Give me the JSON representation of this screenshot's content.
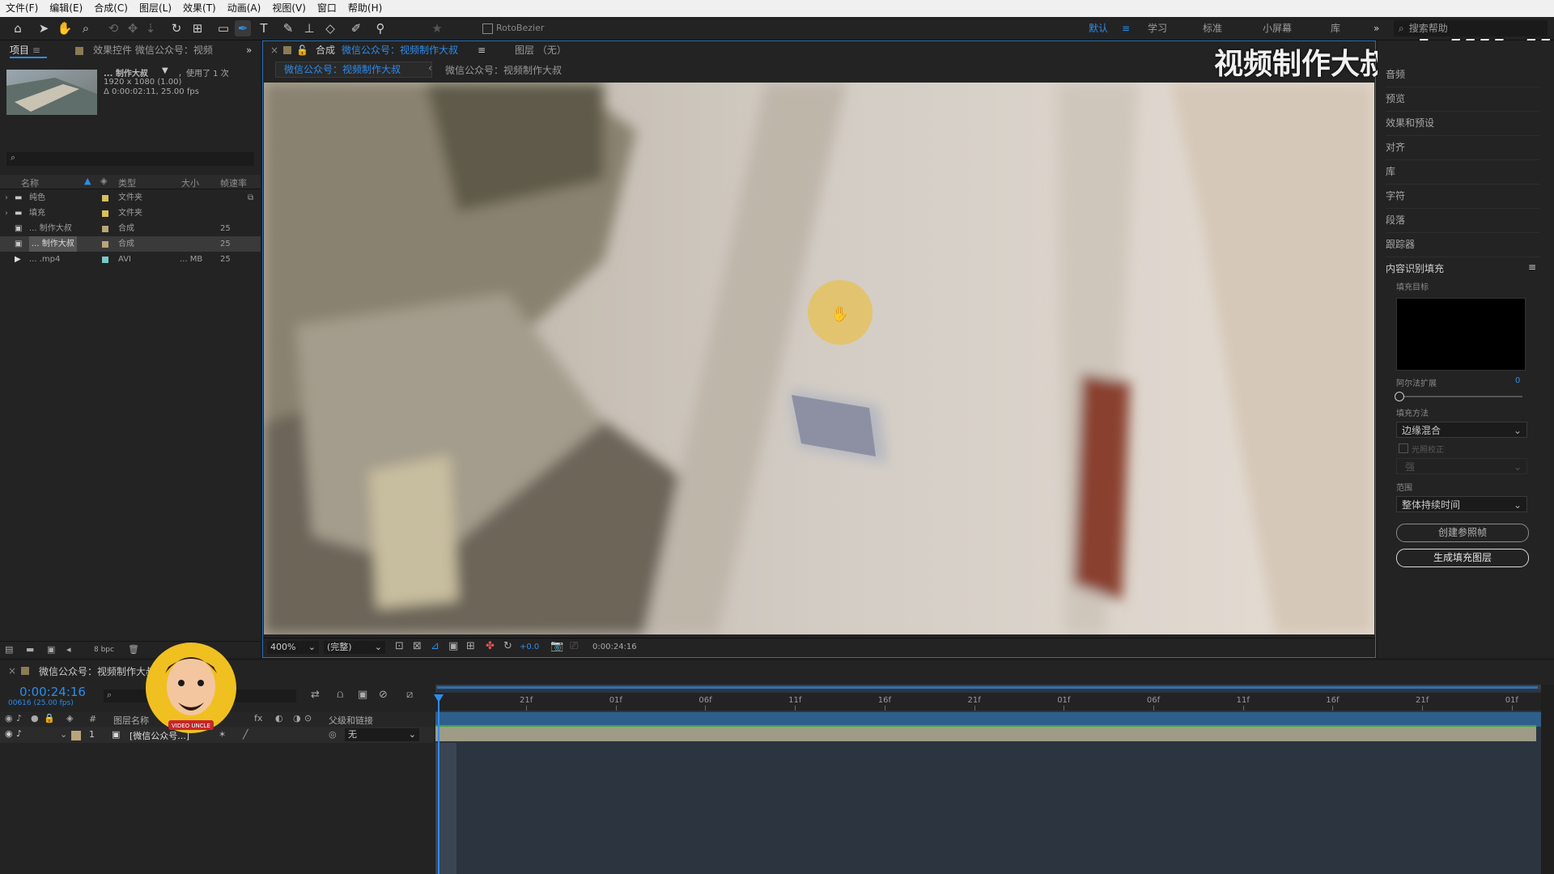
{
  "menu": [
    "文件(F)",
    "编辑(E)",
    "合成(C)",
    "图层(L)",
    "效果(T)",
    "动画(A)",
    "视图(V)",
    "窗口",
    "帮助(H)"
  ],
  "toolbar": {
    "rotobezier": "RotoBezier",
    "workspaces": [
      "默认",
      "学习",
      "标准",
      "小屏幕",
      "库"
    ],
    "active_ws": "默认",
    "search_help": "搜索帮助"
  },
  "watermark": {
    "channel": "视频制作大叔",
    "brand": "bilibili"
  },
  "project": {
    "tab_project": "项目",
    "tab_effects": "效果控件 微信公众号：视频",
    "thumb_name": "... 制作大叔",
    "thumb_used": "，使用了 1 次",
    "thumb_res": "1920 x 1080 (1.00)",
    "thumb_dur": "Δ 0:00:02:11, 25.00 fps",
    "columns": [
      "名称",
      "类型",
      "大小",
      "帧速率"
    ],
    "items": [
      {
        "name": "纯色",
        "type": "文件夹",
        "size": "",
        "fps": ""
      },
      {
        "name": "填充",
        "type": "文件夹",
        "size": "",
        "fps": ""
      },
      {
        "name": "... 制作大叔",
        "type": "合成",
        "size": "",
        "fps": "25"
      },
      {
        "name": "... 制作大叔",
        "type": "合成",
        "size": "",
        "fps": "25"
      },
      {
        "name": "... .mp4",
        "type": "AVI",
        "size": "... MB",
        "fps": "25"
      }
    ],
    "bpc": "8 bpc"
  },
  "comp": {
    "tab_label": "合成",
    "tab_name": "微信公众号：视频制作大叔",
    "layer_tab": "图层 （无）",
    "breadcrumb_active": "微信公众号：视频制作大叔",
    "breadcrumb_next": "微信公众号：视频制作大叔",
    "zoom": "400%",
    "quality": "(完整)",
    "exposure": "+0.0",
    "timecode": "0:00:24:16"
  },
  "right_panel": {
    "items": [
      "音频",
      "预览",
      "效果和预设",
      "对齐",
      "库",
      "字符",
      "段落",
      "跟踪器"
    ],
    "cafill_title": "内容识别填充",
    "fill_target": "填充目标",
    "alpha_expand": "阿尔法扩展",
    "alpha_value": "0",
    "fill_method": "填充方法",
    "fill_method_value": "边缘混合",
    "light_correct": "光照校正",
    "light_value": "强",
    "range": "范围",
    "range_value": "整体持续时间",
    "btn_ref": "创建参照帧",
    "btn_gen": "生成填充图层"
  },
  "timeline": {
    "tab_name": "微信公众号：视频制作大叔",
    "timecode": "0:00:24:16",
    "frame_info": "00616 (25.00 fps)",
    "col_layer": "图层名称",
    "col_parent": "父级和链接",
    "layer_index": "1",
    "layer_name": "[微信公众号...]",
    "parent_value": "无",
    "ruler": [
      "21f",
      "01f",
      "06f",
      "11f",
      "16f",
      "21f",
      "01f",
      "06f",
      "11f",
      "16f",
      "21f",
      "01f"
    ],
    "avatar_caption": "VIDEO UNCLE"
  },
  "colors": {
    "accent": "#2d8ceb",
    "label_yellow": "#d8c05a",
    "label_tan": "#b9a57a",
    "label_cyan": "#79c8c8"
  }
}
